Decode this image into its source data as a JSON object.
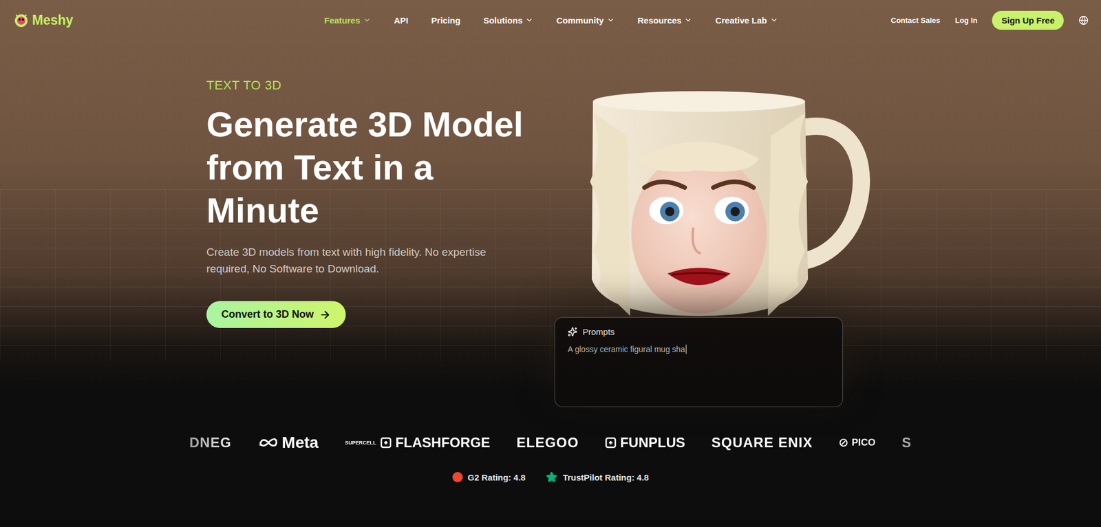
{
  "brand": {
    "name": "Meshy"
  },
  "nav": [
    {
      "label": "Features",
      "dropdown": true,
      "selected": true
    },
    {
      "label": "API",
      "dropdown": false,
      "selected": false
    },
    {
      "label": "Pricing",
      "dropdown": false,
      "selected": false
    },
    {
      "label": "Solutions",
      "dropdown": true,
      "selected": false
    },
    {
      "label": "Community",
      "dropdown": true,
      "selected": false
    },
    {
      "label": "Resources",
      "dropdown": true,
      "selected": false
    },
    {
      "label": "Creative Lab",
      "dropdown": true,
      "selected": false
    }
  ],
  "actions": {
    "contact": "Contact Sales",
    "login": "Log In",
    "signup": "Sign Up Free"
  },
  "hero": {
    "eyebrow": "TEXT TO 3D",
    "title": "Generate 3D Model from Text in a Minute",
    "subtitle": "Create 3D models from text with high fidelity. No expertise required, No Software to Download.",
    "cta": "Convert to 3D Now"
  },
  "prompt": {
    "label": "Prompts",
    "text": "A glossy ceramic figural mug sha"
  },
  "partners": [
    {
      "name": "DNEG",
      "kind": "plain"
    },
    {
      "name": "Meta",
      "kind": "meta"
    },
    {
      "name": "SUPERCELL",
      "kind": "stack"
    },
    {
      "name": "FLASHFORGE",
      "kind": "mark"
    },
    {
      "name": "ELEGOO",
      "kind": "plain"
    },
    {
      "name": "FUNPLUS",
      "kind": "mark"
    },
    {
      "name": "SQUARE ENIX",
      "kind": "plain"
    },
    {
      "name": "PICO",
      "kind": "small"
    },
    {
      "name": "S",
      "kind": "plain"
    }
  ],
  "ratings": [
    {
      "label": "G2 Rating: 4.8",
      "color": "#f0472e"
    },
    {
      "label": "TrustPilot Rating: 4.8",
      "color": "#00b67a"
    }
  ]
}
